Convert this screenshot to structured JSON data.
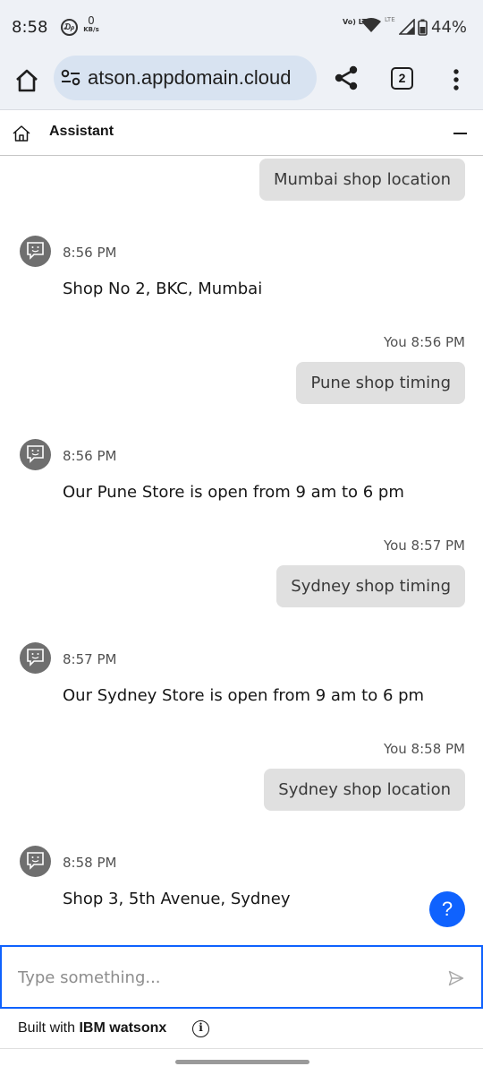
{
  "status_bar": {
    "time": "8:58",
    "net_speed_value": "0",
    "net_speed_unit": "KB/s",
    "volte": "Vo) LTE",
    "lte": "LTE",
    "battery": "44%"
  },
  "browser": {
    "url": "atson.appdomain.cloud",
    "tab_count": "2"
  },
  "assistant": {
    "title": "Assistant"
  },
  "messages": [
    {
      "from": "user",
      "text": "Mumbai shop location"
    },
    {
      "from": "bot",
      "time": "8:56 PM",
      "text": "Shop No 2, BKC, Mumbai"
    },
    {
      "from": "user",
      "meta": "You 8:56 PM",
      "text": "Pune shop timing"
    },
    {
      "from": "bot",
      "time": "8:56 PM",
      "text": "Our Pune Store is open from 9 am to 6 pm"
    },
    {
      "from": "user",
      "meta": "You 8:57 PM",
      "text": "Sydney shop timing"
    },
    {
      "from": "bot",
      "time": "8:57 PM",
      "text": "Our Sydney Store is open from 9 am to 6 pm"
    },
    {
      "from": "user",
      "meta": "You 8:58 PM",
      "text": "Sydney shop location"
    },
    {
      "from": "bot",
      "time": "8:58 PM",
      "text": "Shop 3, 5th Avenue, Sydney"
    }
  ],
  "help_button": "?",
  "input": {
    "placeholder": "Type something...",
    "value": ""
  },
  "footer": {
    "prefix": "Built with ",
    "brand": "IBM watsonx",
    "info_glyph": "i"
  },
  "colors": {
    "accent": "#0f62fe",
    "user_bubble": "#e0e0e0",
    "bot_avatar": "#6f6f6f",
    "browser_bar": "#eef1f6",
    "url_pill": "#d8e3f1"
  }
}
